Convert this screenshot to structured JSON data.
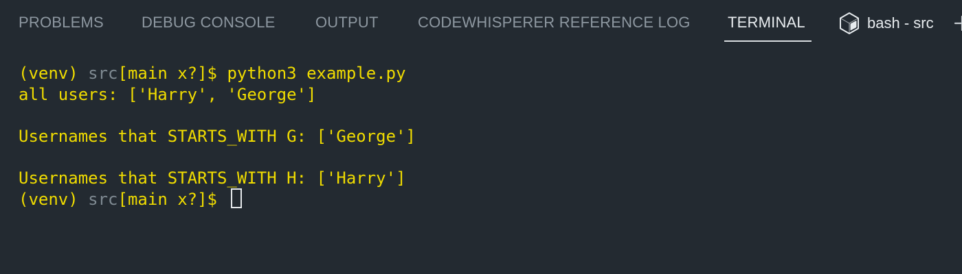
{
  "tabs": [
    {
      "label": "PROBLEMS",
      "active": false
    },
    {
      "label": "DEBUG CONSOLE",
      "active": false
    },
    {
      "label": "OUTPUT",
      "active": false
    },
    {
      "label": "CODEWHISPERER REFERENCE LOG",
      "active": false
    },
    {
      "label": "TERMINAL",
      "active": true
    }
  ],
  "terminal_selector": {
    "label": "bash - src",
    "icon": "terminal-shell-icon"
  },
  "new_terminal_icon": "plus-icon",
  "terminal": {
    "prompt_env": "(venv) ",
    "prompt_dir": "src",
    "prompt_branch": "[main x?]$ ",
    "command": "python3 example.py",
    "output": {
      "all_users": "all users: ['Harry', 'George']",
      "starts_g": "Usernames that STARTS_WITH G: ['George']",
      "starts_h": "Usernames that STARTS_WITH H: ['Harry']"
    }
  },
  "colors": {
    "background": "#232a31",
    "tab_inactive": "#8e98a1",
    "tab_active": "#e8ecef",
    "terminal_text": "#f0dc00",
    "prompt_dir": "#7f8a92"
  }
}
